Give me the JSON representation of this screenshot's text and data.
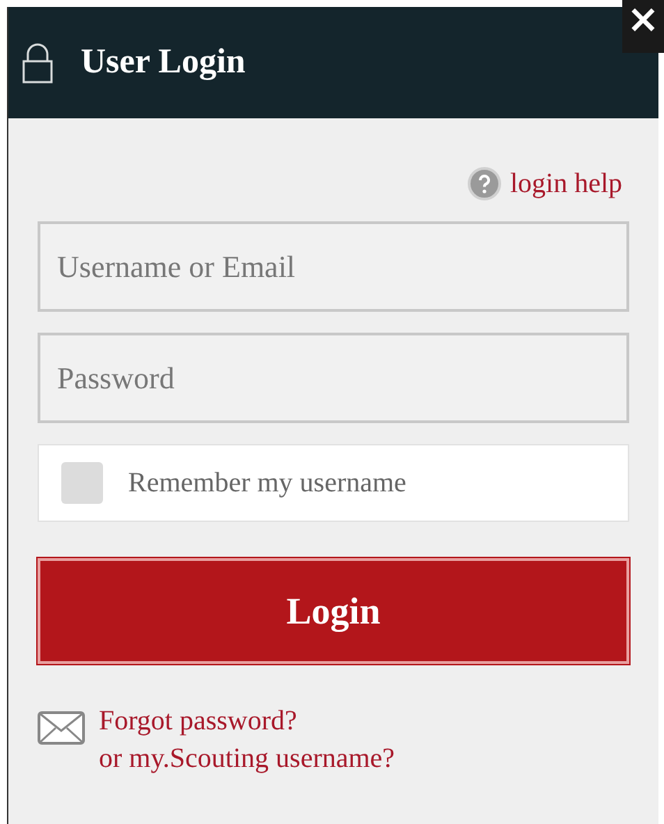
{
  "dialog": {
    "title": "User Login",
    "close": "×"
  },
  "help_link": "login help",
  "username_field": {
    "placeholder": "Username or Email"
  },
  "password_field": {
    "placeholder": "Password"
  },
  "remember": {
    "label": "Remember my username",
    "checked": false
  },
  "login_button": "Login",
  "forgot_link": "Forgot password?\nor my.Scouting username?"
}
